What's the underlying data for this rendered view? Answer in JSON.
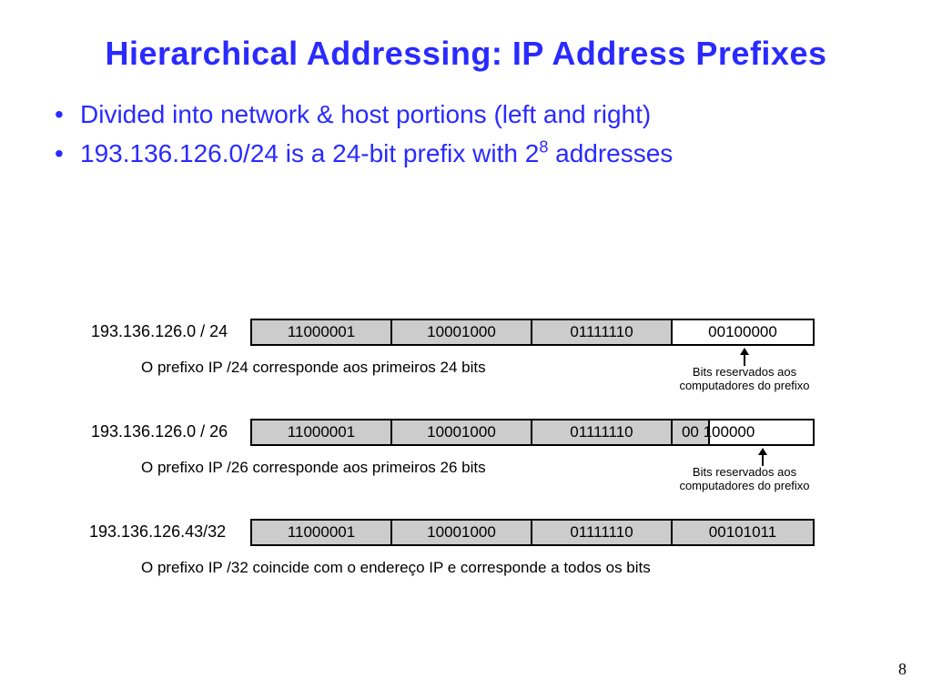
{
  "title": "Hierarchical Addressing: IP Address Prefixes",
  "bullets": {
    "b1": "Divided into network & host portions (left and right)",
    "b2_pre": "193.136.126.0/24 is a 24-bit prefix with 2",
    "b2_sup": "8",
    "b2_post": " addresses"
  },
  "rows": {
    "r1": {
      "label": "193.136.126.0 / 24",
      "octets": {
        "o1": "11000001",
        "o2": "10001000",
        "o3": "01111110",
        "o4": "00100000"
      },
      "caption": "O prefixo IP /24 corresponde aos primeiros 24 bits",
      "note": "Bits reservados aos\ncomputadores do prefixo"
    },
    "r2": {
      "label": "193.136.126.0 / 26",
      "octets": {
        "o1": "11000001",
        "o2": "10001000",
        "o3": "01111110",
        "o4a": "00",
        "o4b": " 100000"
      },
      "caption": "O prefixo IP /26 corresponde aos primeiros 26 bits",
      "note": "Bits reservados aos\ncomputadores do prefixo"
    },
    "r3": {
      "label": "193.136.126.43/32",
      "octets": {
        "o1": "11000001",
        "o2": "10001000",
        "o3": "01111110",
        "o4": "00101011"
      },
      "caption": "O prefixo IP /32 coincide com o endereço IP e corresponde a todos os bits"
    }
  },
  "page_number": "8"
}
